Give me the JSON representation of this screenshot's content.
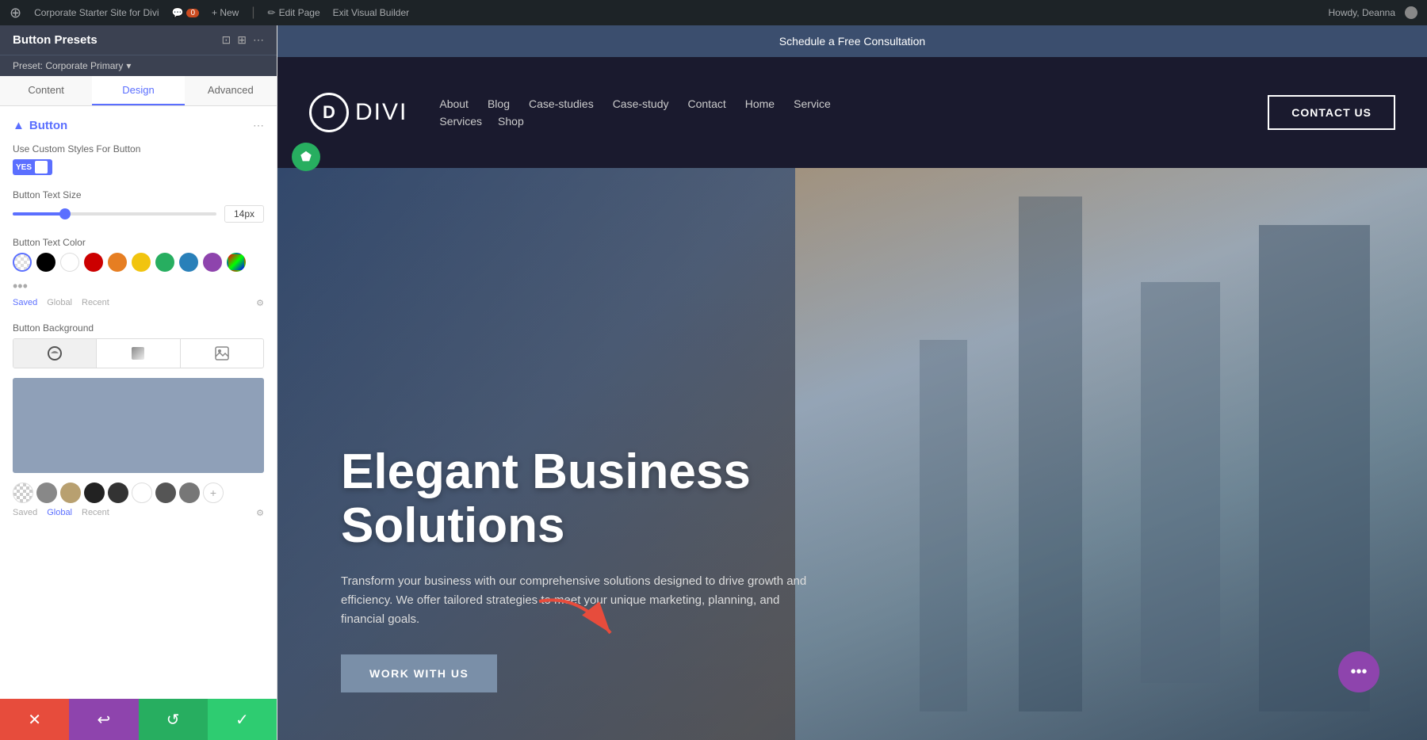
{
  "admin_bar": {
    "wp_icon": "W",
    "site_name": "Corporate Starter Site for Divi",
    "comments": "0",
    "new_label": "+ New",
    "edit_page": "Edit Page",
    "exit_builder": "Exit Visual Builder",
    "howdy": "Howdy, Deanna"
  },
  "panel": {
    "title": "Button Presets",
    "preset": "Preset: Corporate Primary",
    "tabs": [
      "Content",
      "Design",
      "Advanced"
    ],
    "active_tab": "Design",
    "section_title": "Button",
    "toggle_label": "Use Custom Styles For Button",
    "toggle_value": "YES",
    "text_size_label": "Button Text Size",
    "text_size_value": "14px",
    "text_color_label": "Button Text Color",
    "color_tabs": [
      "Saved",
      "Global",
      "Recent"
    ],
    "bg_label": "Button Background",
    "colors": [
      {
        "name": "transparent",
        "value": "transparent"
      },
      {
        "name": "black",
        "value": "#000000"
      },
      {
        "name": "white",
        "value": "#ffffff"
      },
      {
        "name": "red",
        "value": "#cc0000"
      },
      {
        "name": "orange",
        "value": "#e67e22"
      },
      {
        "name": "yellow",
        "value": "#f1c40f"
      },
      {
        "name": "green",
        "value": "#27ae60"
      },
      {
        "name": "blue",
        "value": "#2980b9"
      },
      {
        "name": "purple",
        "value": "#8e44ad"
      },
      {
        "name": "edit",
        "value": "edit"
      }
    ],
    "bottom_swatches": [
      {
        "color": "transparent"
      },
      {
        "color": "#888"
      },
      {
        "color": "#b8a070"
      },
      {
        "color": "#222"
      },
      {
        "color": "#333"
      },
      {
        "color": "#fff"
      },
      {
        "color": "#555"
      },
      {
        "color": "#777"
      }
    ],
    "preview_color": "#8fa0b8"
  },
  "footer_buttons": {
    "cancel": "✕",
    "undo": "↩",
    "redo": "↺",
    "save": "✓"
  },
  "notification_bar": {
    "text": "Schedule a Free Consultation"
  },
  "site_nav": {
    "logo_letter": "D",
    "logo_text": "DIVI",
    "primary_links": [
      "About",
      "Blog",
      "Case-studies",
      "Case-study",
      "Contact",
      "Home",
      "Service"
    ],
    "secondary_links": [
      "Services",
      "Shop"
    ],
    "contact_btn": "CONTACT US"
  },
  "hero": {
    "title": "Elegant Business Solutions",
    "subtitle": "Transform your business with our comprehensive solutions designed to drive growth and efficiency. We offer tailored strategies to meet your unique marketing, planning, and financial goals.",
    "cta_label": "WORK WITH US"
  },
  "fab": {
    "icon": "•••"
  }
}
